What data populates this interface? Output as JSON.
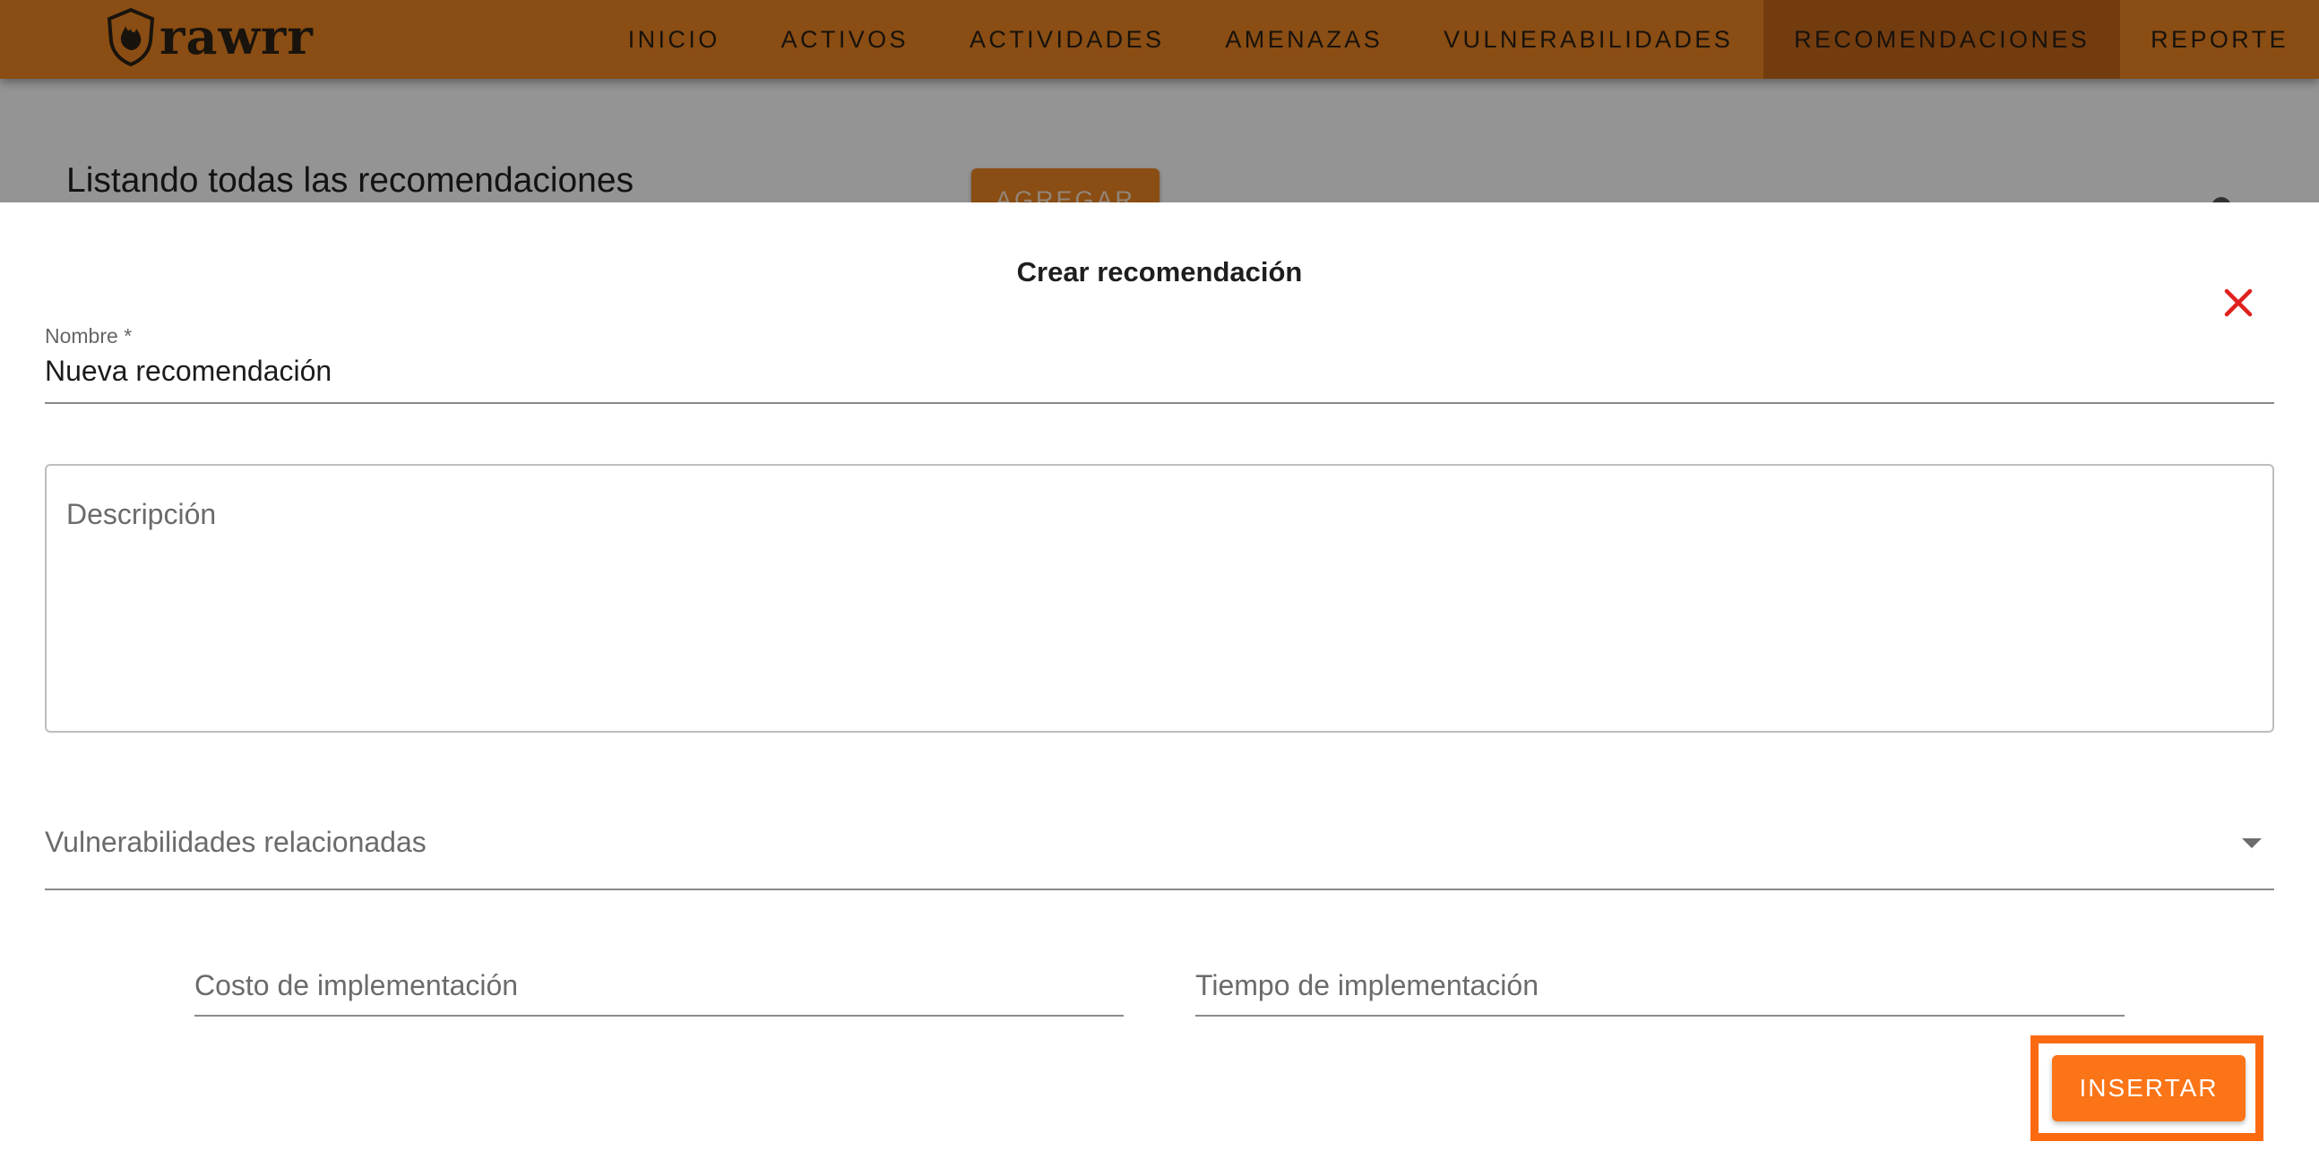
{
  "app": {
    "logo_text": "rawrr",
    "nav": [
      {
        "label": "INICIO",
        "active": false
      },
      {
        "label": "ACTIVOS",
        "active": false
      },
      {
        "label": "ACTIVIDADES",
        "active": false
      },
      {
        "label": "AMENAZAS",
        "active": false
      },
      {
        "label": "VULNERABILIDADES",
        "active": false
      },
      {
        "label": "RECOMENDACIONES",
        "active": true
      },
      {
        "label": "REPORTE",
        "active": false
      }
    ],
    "page_title": "Listando todas las recomendaciones",
    "add_button_label": "AGREGAR"
  },
  "dialog": {
    "title": "Crear recomendación",
    "nombre": {
      "label": "Nombre *",
      "value": "Nueva recomendación"
    },
    "descripcion": {
      "placeholder": "Descripción"
    },
    "vulnerabilidades": {
      "placeholder": "Vulnerabilidades relacionadas"
    },
    "costo": {
      "placeholder": "Costo de implementación"
    },
    "tiempo": {
      "placeholder": "Tiempo de implementación"
    },
    "insert_label": "INSERTAR"
  },
  "colors": {
    "topbar": "#ee8621",
    "nav_active": "#c7681a",
    "accent": "#fb7417",
    "close": "#e0201c"
  },
  "icons": {
    "logo": "shield-flame-icon",
    "close": "close-icon",
    "dropdown": "caret-down-icon"
  }
}
